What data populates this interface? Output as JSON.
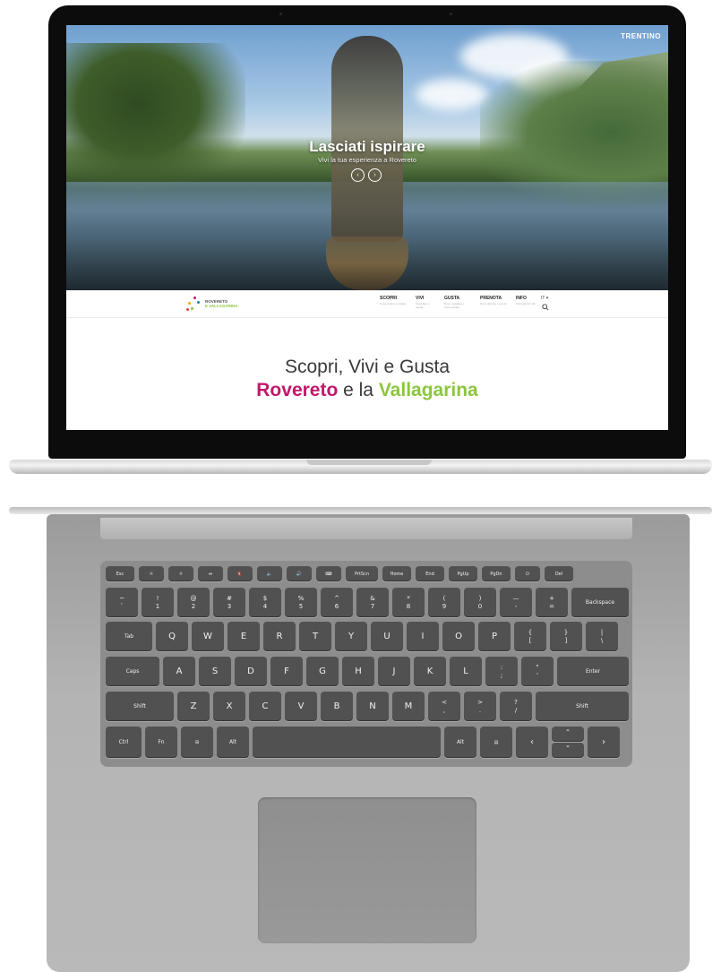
{
  "hero": {
    "title": "Lasciati ispirare",
    "subtitle": "Vivi la tua esperienza a Rovereto",
    "prev_icon": "chevron-left-icon",
    "next_icon": "chevron-right-icon",
    "brand_topright": "TRENTINO"
  },
  "nav": {
    "logo_line1": "ROVERETO",
    "logo_line2": "E VALLAGARINA",
    "items": [
      {
        "label": "SCOPRI",
        "hint": "Cosa vedere e visitare"
      },
      {
        "label": "VIVI",
        "hint": "Cosa fare e eventi"
      },
      {
        "label": "GUSTA",
        "hint": "Dove mangiare e cosa gustare"
      },
      {
        "label": "PRENOTA",
        "hint": "Dove dormire e servizi"
      },
      {
        "label": "INFO",
        "hint": "Informazioni utili"
      }
    ],
    "lang": "IT ▾",
    "search_icon": "search-icon"
  },
  "content": {
    "line1": "Scopri, Vivi e Gusta",
    "line2_pink": "Rovereto",
    "line2_mid": " e la ",
    "line2_green": "Vallagarina"
  },
  "colors": {
    "accent_pink": "#c2186b",
    "accent_green": "#8cc63e"
  },
  "keyboard": {
    "row_fn": [
      "Esc",
      "☼",
      "☼",
      "⏯",
      "🔇",
      "🔉",
      "🔊",
      "⌨",
      "PrtScn",
      "Home",
      "End",
      "PgUp",
      "PgDn",
      "⏻",
      "Del"
    ],
    "row_num": [
      [
        "~",
        "`"
      ],
      [
        "!",
        "1"
      ],
      [
        "@",
        "2"
      ],
      [
        "#",
        "3"
      ],
      [
        "$",
        "4"
      ],
      [
        "%",
        "5"
      ],
      [
        "^",
        "6"
      ],
      [
        "&",
        "7"
      ],
      [
        "*",
        "8"
      ],
      [
        "(",
        "9"
      ],
      [
        ")",
        "0"
      ],
      [
        "—",
        "-"
      ],
      [
        "+",
        "="
      ]
    ],
    "backspace": "Backspace",
    "tab": "Tab",
    "row_q": [
      "Q",
      "W",
      "E",
      "R",
      "T",
      "Y",
      "U",
      "I",
      "O",
      "P"
    ],
    "row_q_sym": [
      [
        "{",
        "["
      ],
      [
        "}",
        "]"
      ],
      [
        "|",
        "\\"
      ]
    ],
    "caps": "Caps",
    "row_a": [
      "A",
      "S",
      "D",
      "F",
      "G",
      "H",
      "J",
      "K",
      "L"
    ],
    "row_a_sym": [
      [
        ":",
        ";"
      ],
      [
        "\"",
        "'"
      ]
    ],
    "enter": "Enter",
    "shift_l": "Shift",
    "row_z": [
      "Z",
      "X",
      "C",
      "V",
      "B",
      "N",
      "M"
    ],
    "row_z_sym": [
      [
        "<",
        ","
      ],
      [
        ">",
        "."
      ],
      [
        "?",
        "/"
      ]
    ],
    "shift_r": "Shift",
    "ctrl": "Ctrl",
    "fn": "Fn",
    "win_icon": "windows-icon",
    "alt_l": "Alt",
    "alt_r": "Alt",
    "menu_icon": "menu-key-icon",
    "left": "‹",
    "up": "ˆ",
    "down": "ˇ",
    "right": "›"
  }
}
